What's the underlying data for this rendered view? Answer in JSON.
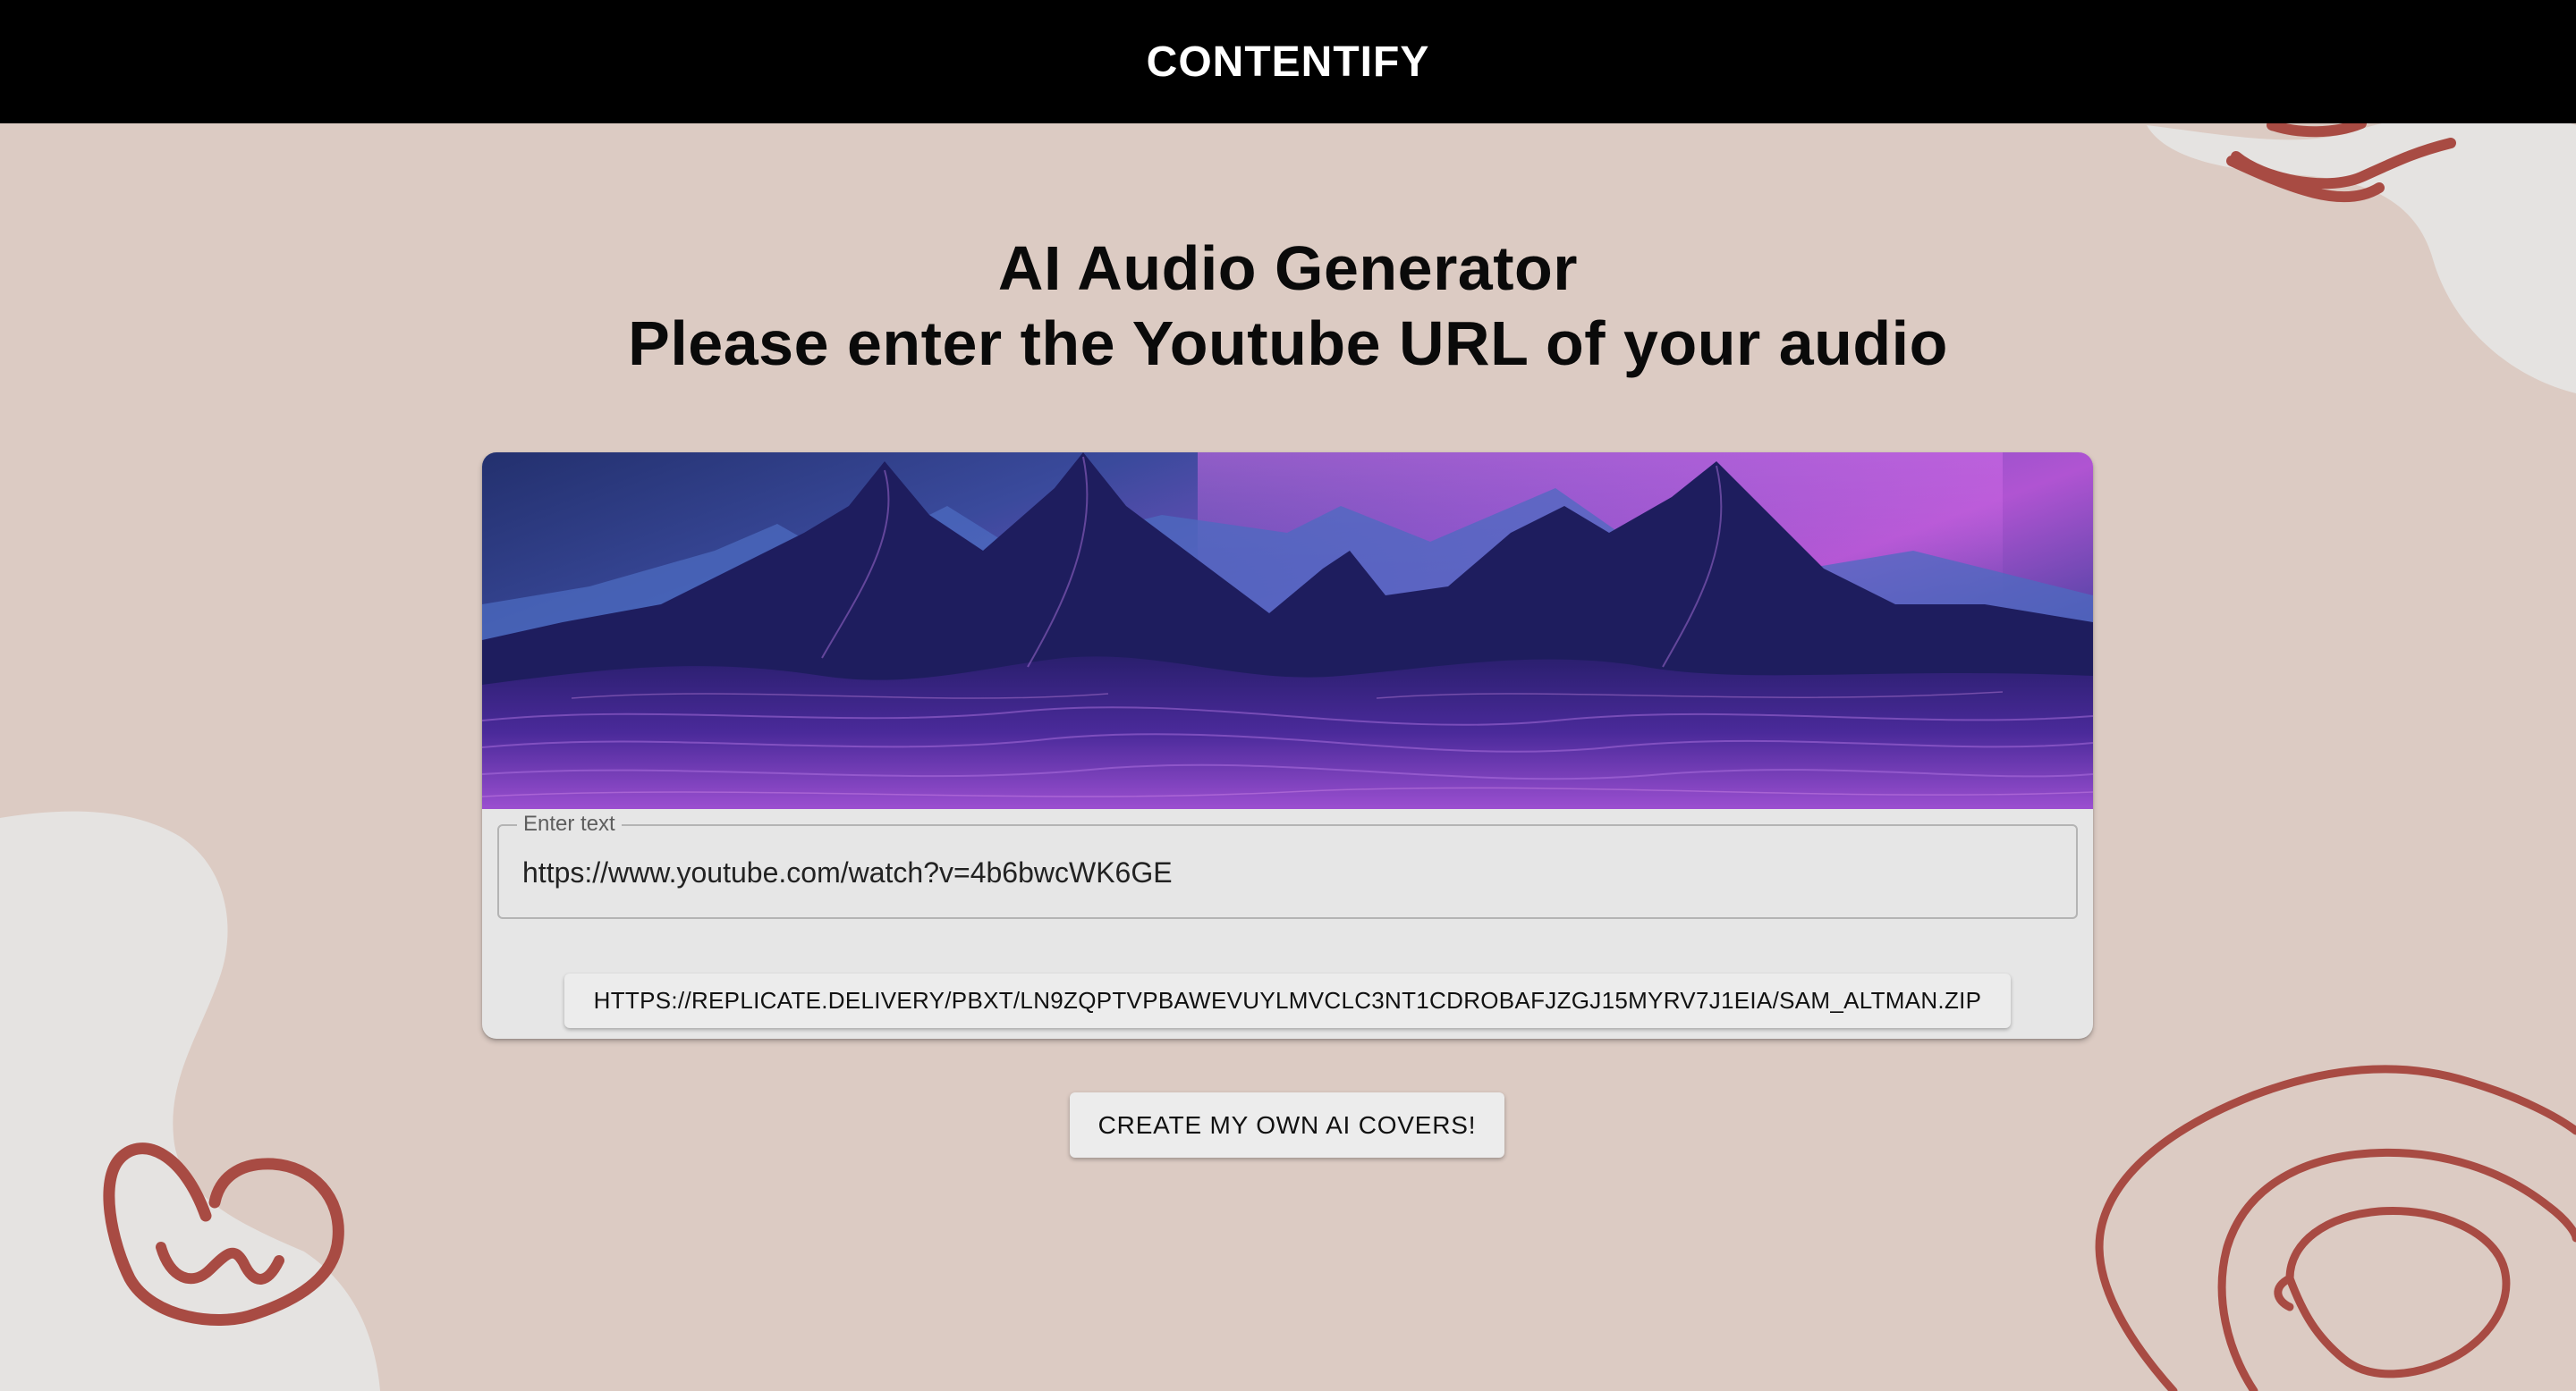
{
  "header": {
    "brand": "CONTENTIFY"
  },
  "main": {
    "title": "AI Audio Generator",
    "subtitle": "Please enter the Youtube URL of your audio"
  },
  "card": {
    "banner_icon": "purple-mountain-waves-image",
    "input": {
      "label": "Enter text",
      "value": "https://www.youtube.com/watch?v=4b6bwcWK6GE"
    },
    "result_link": "HTTPS://REPLICATE.DELIVERY/PBXT/LN9ZQPTVPBAWEVUYLMVCLC3NT1CDROBAFJZGJ15MYRV7J1EIA/SAM_ALTMAN.ZIP"
  },
  "cta": {
    "label": "CREATE MY OWN AI COVERS!"
  },
  "colors": {
    "background": "#dccbc3",
    "header": "#000000",
    "blob": "#e5e3e1",
    "squiggle": "#a84b43"
  }
}
